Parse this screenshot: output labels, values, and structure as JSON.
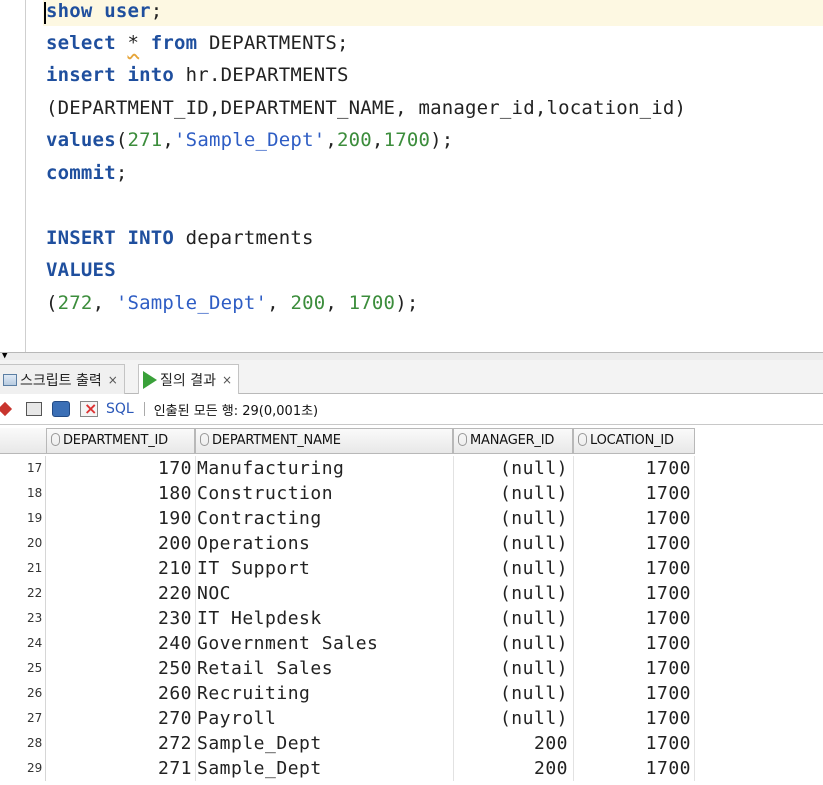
{
  "editor": {
    "lines": [
      [
        {
          "t": "show user",
          "c": "kw"
        },
        {
          "t": ";",
          "c": ""
        }
      ],
      [
        {
          "t": "select",
          "c": "kw"
        },
        {
          "t": " ",
          "c": ""
        },
        {
          "t": "*",
          "c": "squig"
        },
        {
          "t": " ",
          "c": ""
        },
        {
          "t": "from",
          "c": "kw"
        },
        {
          "t": " DEPARTMENTS;",
          "c": ""
        }
      ],
      [
        {
          "t": "insert into",
          "c": "kw"
        },
        {
          "t": " hr.DEPARTMENTS",
          "c": ""
        }
      ],
      [
        {
          "t": "(DEPARTMENT_ID,DEPARTMENT_NAME, manager_id,location_id)",
          "c": ""
        }
      ],
      [
        {
          "t": "values",
          "c": "kw"
        },
        {
          "t": "(",
          "c": ""
        },
        {
          "t": "271",
          "c": "num"
        },
        {
          "t": ",",
          "c": ""
        },
        {
          "t": "'Sample_Dept'",
          "c": "str"
        },
        {
          "t": ",",
          "c": ""
        },
        {
          "t": "200",
          "c": "num"
        },
        {
          "t": ",",
          "c": ""
        },
        {
          "t": "1700",
          "c": "num"
        },
        {
          "t": ");",
          "c": ""
        }
      ],
      [
        {
          "t": "commit",
          "c": "kw"
        },
        {
          "t": ";",
          "c": ""
        }
      ],
      [],
      [
        {
          "t": "INSERT INTO",
          "c": "kw"
        },
        {
          "t": " departments",
          "c": ""
        }
      ],
      [
        {
          "t": "VALUES",
          "c": "kw"
        }
      ],
      [
        {
          "t": "(",
          "c": ""
        },
        {
          "t": "272",
          "c": "num"
        },
        {
          "t": ", ",
          "c": ""
        },
        {
          "t": "'Sample_Dept'",
          "c": "str"
        },
        {
          "t": ", ",
          "c": ""
        },
        {
          "t": "200",
          "c": "num"
        },
        {
          "t": ", ",
          "c": ""
        },
        {
          "t": "1700",
          "c": "num"
        },
        {
          "t": ");",
          "c": ""
        }
      ]
    ]
  },
  "tabs": {
    "script_output": "스크립트 출력",
    "query_result": "질의 결과",
    "close": "×"
  },
  "toolbar": {
    "sql_label": "SQL",
    "status": "인출된 모든 행: 29(0,001초)"
  },
  "grid": {
    "columns": [
      "DEPARTMENT_ID",
      "DEPARTMENT_NAME",
      "MANAGER_ID",
      "LOCATION_ID"
    ],
    "rows": [
      {
        "rn": "17",
        "id": "170",
        "name": "Manufacturing",
        "mgr": "(null)",
        "loc": "1700"
      },
      {
        "rn": "18",
        "id": "180",
        "name": "Construction",
        "mgr": "(null)",
        "loc": "1700"
      },
      {
        "rn": "19",
        "id": "190",
        "name": "Contracting",
        "mgr": "(null)",
        "loc": "1700"
      },
      {
        "rn": "20",
        "id": "200",
        "name": "Operations",
        "mgr": "(null)",
        "loc": "1700"
      },
      {
        "rn": "21",
        "id": "210",
        "name": "IT Support",
        "mgr": "(null)",
        "loc": "1700"
      },
      {
        "rn": "22",
        "id": "220",
        "name": "NOC",
        "mgr": "(null)",
        "loc": "1700"
      },
      {
        "rn": "23",
        "id": "230",
        "name": "IT Helpdesk",
        "mgr": "(null)",
        "loc": "1700"
      },
      {
        "rn": "24",
        "id": "240",
        "name": "Government Sales",
        "mgr": "(null)",
        "loc": "1700"
      },
      {
        "rn": "25",
        "id": "250",
        "name": "Retail Sales",
        "mgr": "(null)",
        "loc": "1700"
      },
      {
        "rn": "26",
        "id": "260",
        "name": "Recruiting",
        "mgr": "(null)",
        "loc": "1700"
      },
      {
        "rn": "27",
        "id": "270",
        "name": "Payroll",
        "mgr": "(null)",
        "loc": "1700"
      },
      {
        "rn": "28",
        "id": "272",
        "name": "Sample_Dept",
        "mgr": "200",
        "loc": "1700"
      },
      {
        "rn": "29",
        "id": "271",
        "name": "Sample_Dept",
        "mgr": "200",
        "loc": "1700"
      }
    ]
  }
}
